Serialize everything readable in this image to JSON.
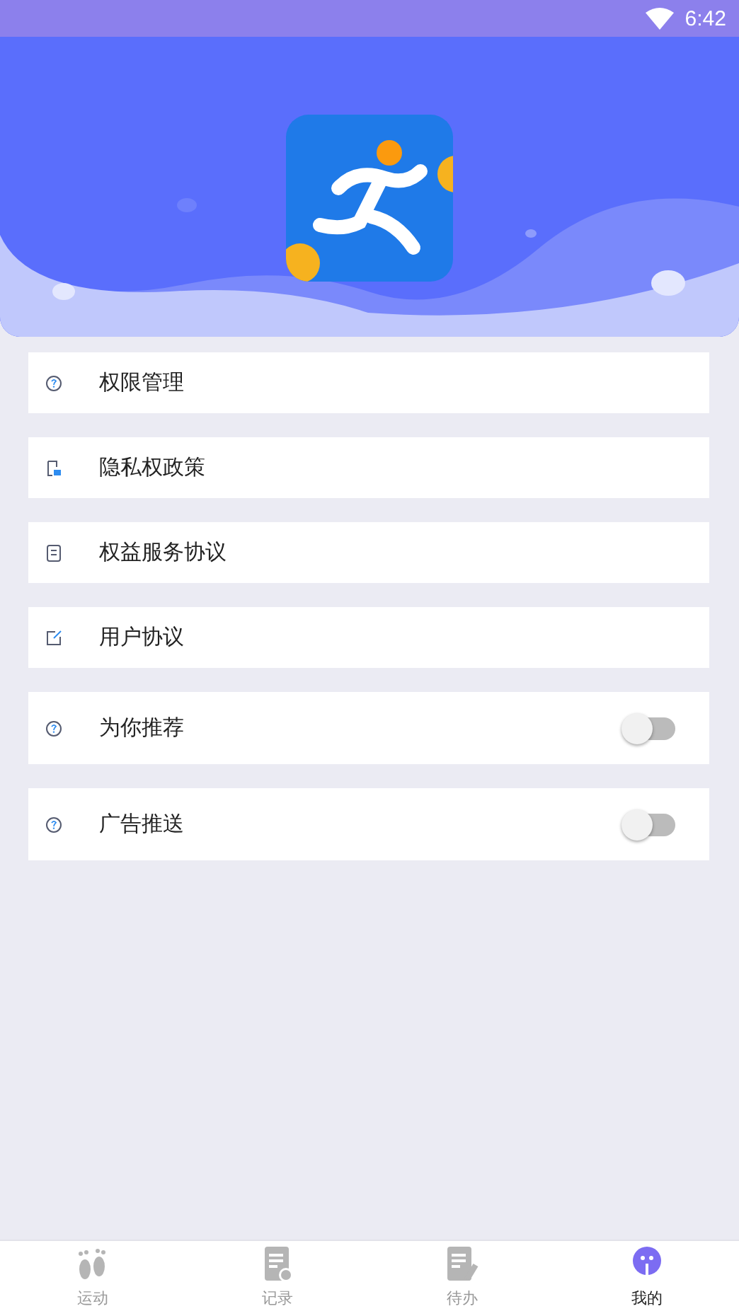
{
  "status_bar": {
    "time": "6:42"
  },
  "settings": [
    {
      "kind": "link",
      "label": "权限管理"
    },
    {
      "kind": "link",
      "label": "隐私权政策"
    },
    {
      "kind": "link",
      "label": "权益服务协议"
    },
    {
      "kind": "link",
      "label": "用户协议"
    },
    {
      "kind": "toggle",
      "label": "为你推荐",
      "on": false
    },
    {
      "kind": "toggle",
      "label": "广告推送",
      "on": false
    }
  ],
  "tabs": [
    {
      "label": "运动",
      "selected": false
    },
    {
      "label": "记录",
      "selected": false
    },
    {
      "label": "待办",
      "selected": false
    },
    {
      "label": "我的",
      "selected": true
    }
  ]
}
